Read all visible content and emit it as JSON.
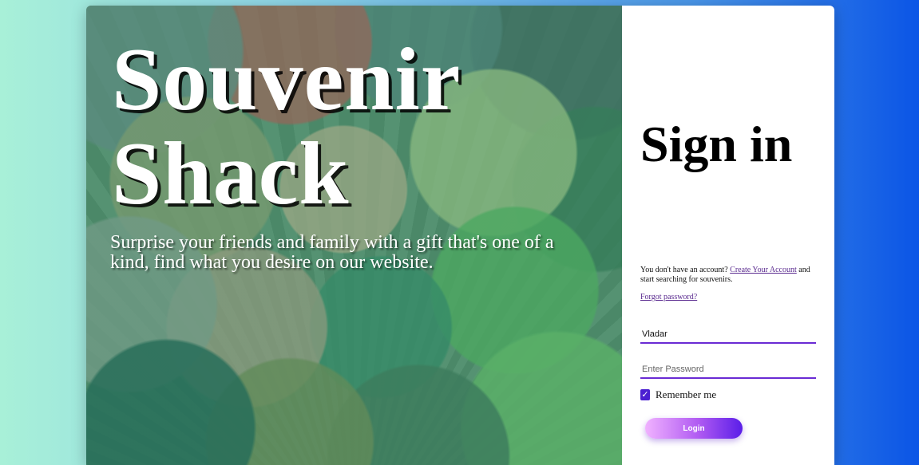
{
  "hero": {
    "brand_line1": "Souvenir",
    "brand_line2": "Shack",
    "tagline": "Surprise your friends and family with a gift that's one of a kind, find what you desire on our website."
  },
  "signin": {
    "title": "Sign in",
    "account_prompt": "You don't have an account?",
    "create_account_link": "Create Your Account",
    "account_suffix": "and start searching for souvenirs.",
    "forgot_password_link": "Forgot password?",
    "username_value": "Vladar",
    "password_placeholder": "Enter Password",
    "remember_label": "Remember me",
    "remember_checked": true,
    "login_button": "Login"
  },
  "colors": {
    "accent": "#6a2bd4",
    "checkbox": "#4b1fd1",
    "link": "#5a2a8f"
  },
  "icons": {
    "checkbox_check": "check-icon"
  }
}
